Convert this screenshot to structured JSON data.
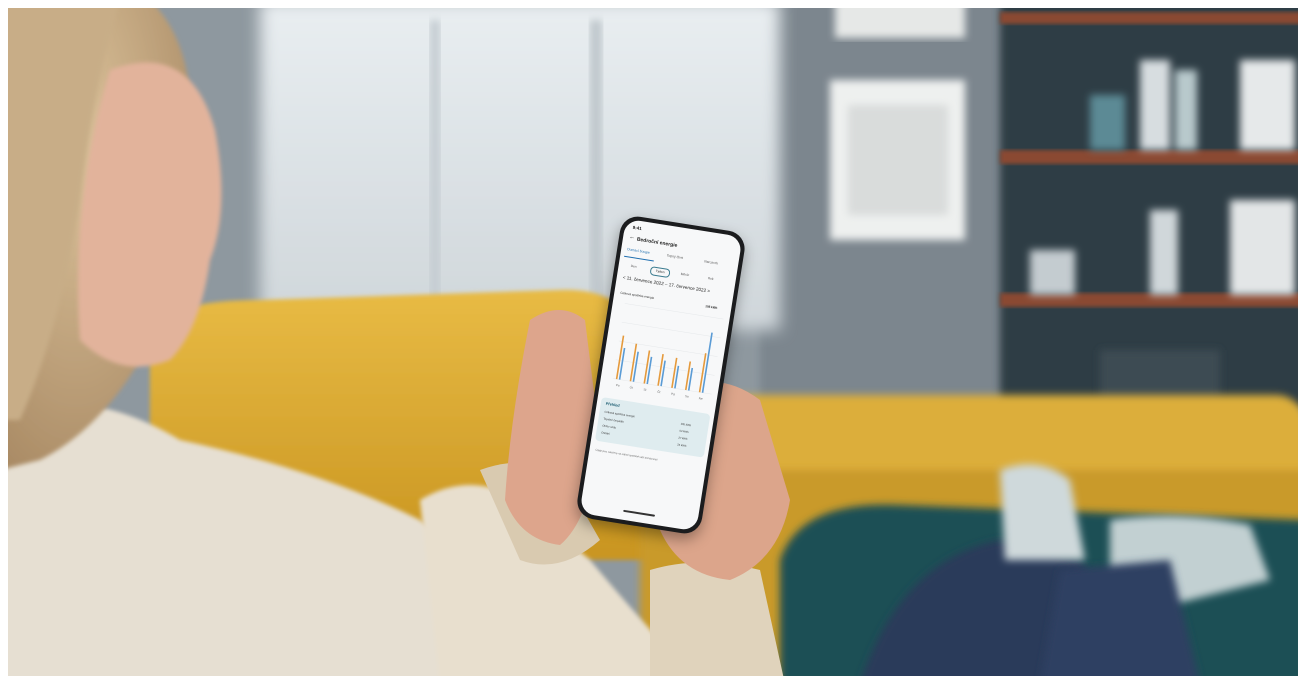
{
  "phone_screen": {
    "status_time": "9:41",
    "title": "Bedroční energie",
    "back_icon": "back-arrow-icon",
    "tabs": [
      {
        "label": "Domácí boogie",
        "active": true
      },
      {
        "label": "Topný čtvrt",
        "active": false
      },
      {
        "label": "Nerozvrh",
        "active": false
      }
    ],
    "periods": [
      {
        "label": "Den",
        "selected": false
      },
      {
        "label": "Týden",
        "selected": true
      },
      {
        "label": "Měsíc",
        "selected": false
      },
      {
        "label": "Rok",
        "selected": false
      }
    ],
    "date_range": "< 11. července 2022 – 17. července 2022 >",
    "total_label": "Celková spotřeba energie",
    "total_value": "105 kWh",
    "summary": {
      "title": "Přehled",
      "rows": [
        {
          "label": "Celková spotřeba energie",
          "value": "105 kWh"
        },
        {
          "label": "Tepelné čerpadlo",
          "value": "54 kWh"
        },
        {
          "label": "Ohřev vody",
          "value": "27 kWh"
        },
        {
          "label": "Ostatní",
          "value": "24 kWh"
        }
      ]
    },
    "footnote": "Údaje jsou založeny na reálné spotřebě vaší domácnosti"
  },
  "colors": {
    "sofa": "#e3b33a",
    "wall": "#7f8a93",
    "sweater": "#e6dfd2",
    "hair": "#cdb38f",
    "skin": "#d8a48a",
    "shelf": "#8a4a32",
    "phone_body": "#1b1c1e",
    "accent_blue": "#1f6fb0",
    "bar_orange": "#e59a3c",
    "bar_blue": "#5a9bd5"
  },
  "chart_data": {
    "type": "bar",
    "categories": [
      "Po",
      "Út",
      "St",
      "Čt",
      "Pá",
      "So",
      "Ne"
    ],
    "series": [
      {
        "values": [
          58,
          50,
          44,
          42,
          40,
          38,
          52
        ]
      },
      {
        "values": [
          42,
          40,
          36,
          34,
          30,
          30,
          80
        ]
      }
    ],
    "ylim": [
      0,
      100
    ]
  }
}
